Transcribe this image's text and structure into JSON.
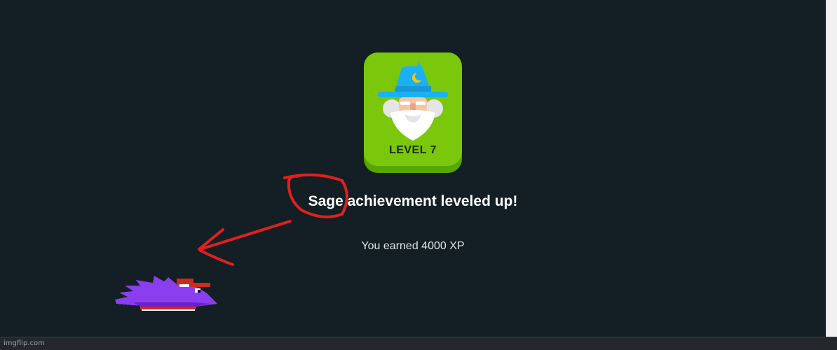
{
  "badge": {
    "level_label": "LEVEL 7",
    "icon": "wizard-icon",
    "colors": {
      "face": "#7ac70c",
      "shadow": "#58a700",
      "hat": "#1cb0f6"
    }
  },
  "message": {
    "title": "Sage achievement leveled up!",
    "subtitle": "You earned 4000 XP"
  },
  "annotation": {
    "circle_color": "#e02020",
    "arrow_color": "#e02020"
  },
  "sprite": {
    "icon": "purple-bird-sprite",
    "colors": {
      "body": "#8a3ef0",
      "cap": "#d12a1a"
    }
  },
  "watermark": "imgflip.com",
  "background": "#131f24"
}
